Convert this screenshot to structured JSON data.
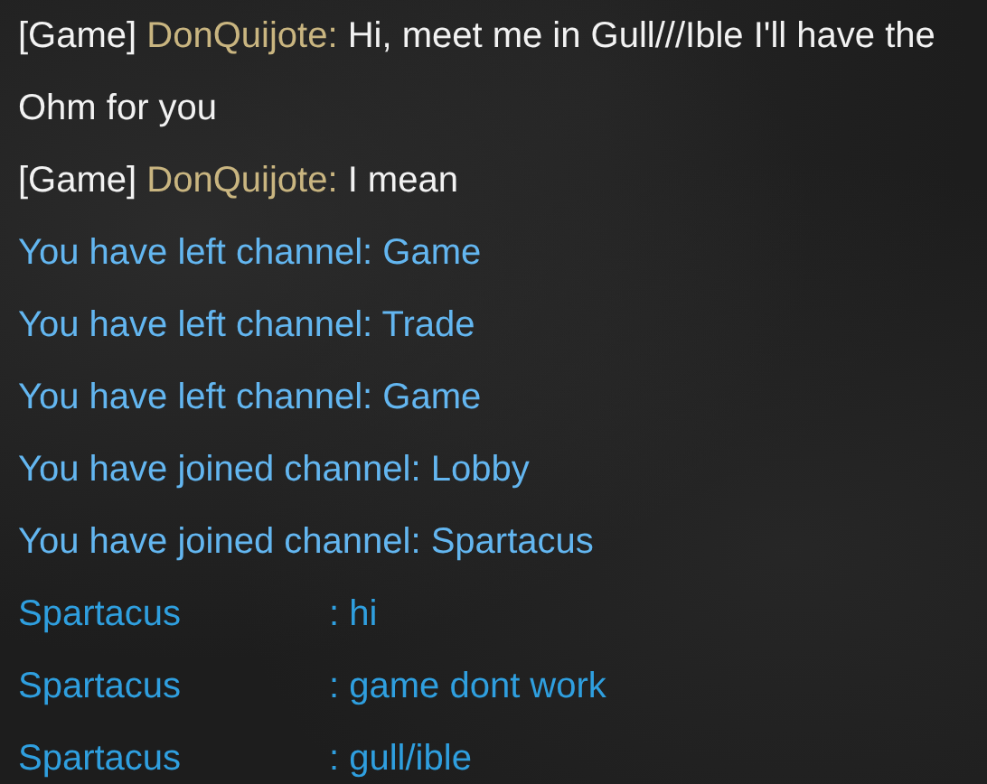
{
  "messages": [
    {
      "kind": "game",
      "channel": "[Game]",
      "sender": "DonQuijote:",
      "text": "Hi, meet me in Gull///Ible I'll have the Ohm for you"
    },
    {
      "kind": "game",
      "channel": "[Game]",
      "sender": "DonQuijote:",
      "text": "I mean"
    },
    {
      "kind": "system",
      "text": "You have left channel: Game"
    },
    {
      "kind": "system",
      "text": "You have left channel: Trade"
    },
    {
      "kind": "system",
      "text": "You have left channel: Game"
    },
    {
      "kind": "system",
      "text": "You have joined channel: Lobby"
    },
    {
      "kind": "system",
      "text": "You have joined channel: Spartacus"
    },
    {
      "kind": "channel",
      "sender": "Spartacus",
      "text": ": hi"
    },
    {
      "kind": "channel",
      "sender": "Spartacus",
      "text": ": game dont work"
    },
    {
      "kind": "channel",
      "sender": "Spartacus",
      "text": ": gull/ible"
    }
  ]
}
